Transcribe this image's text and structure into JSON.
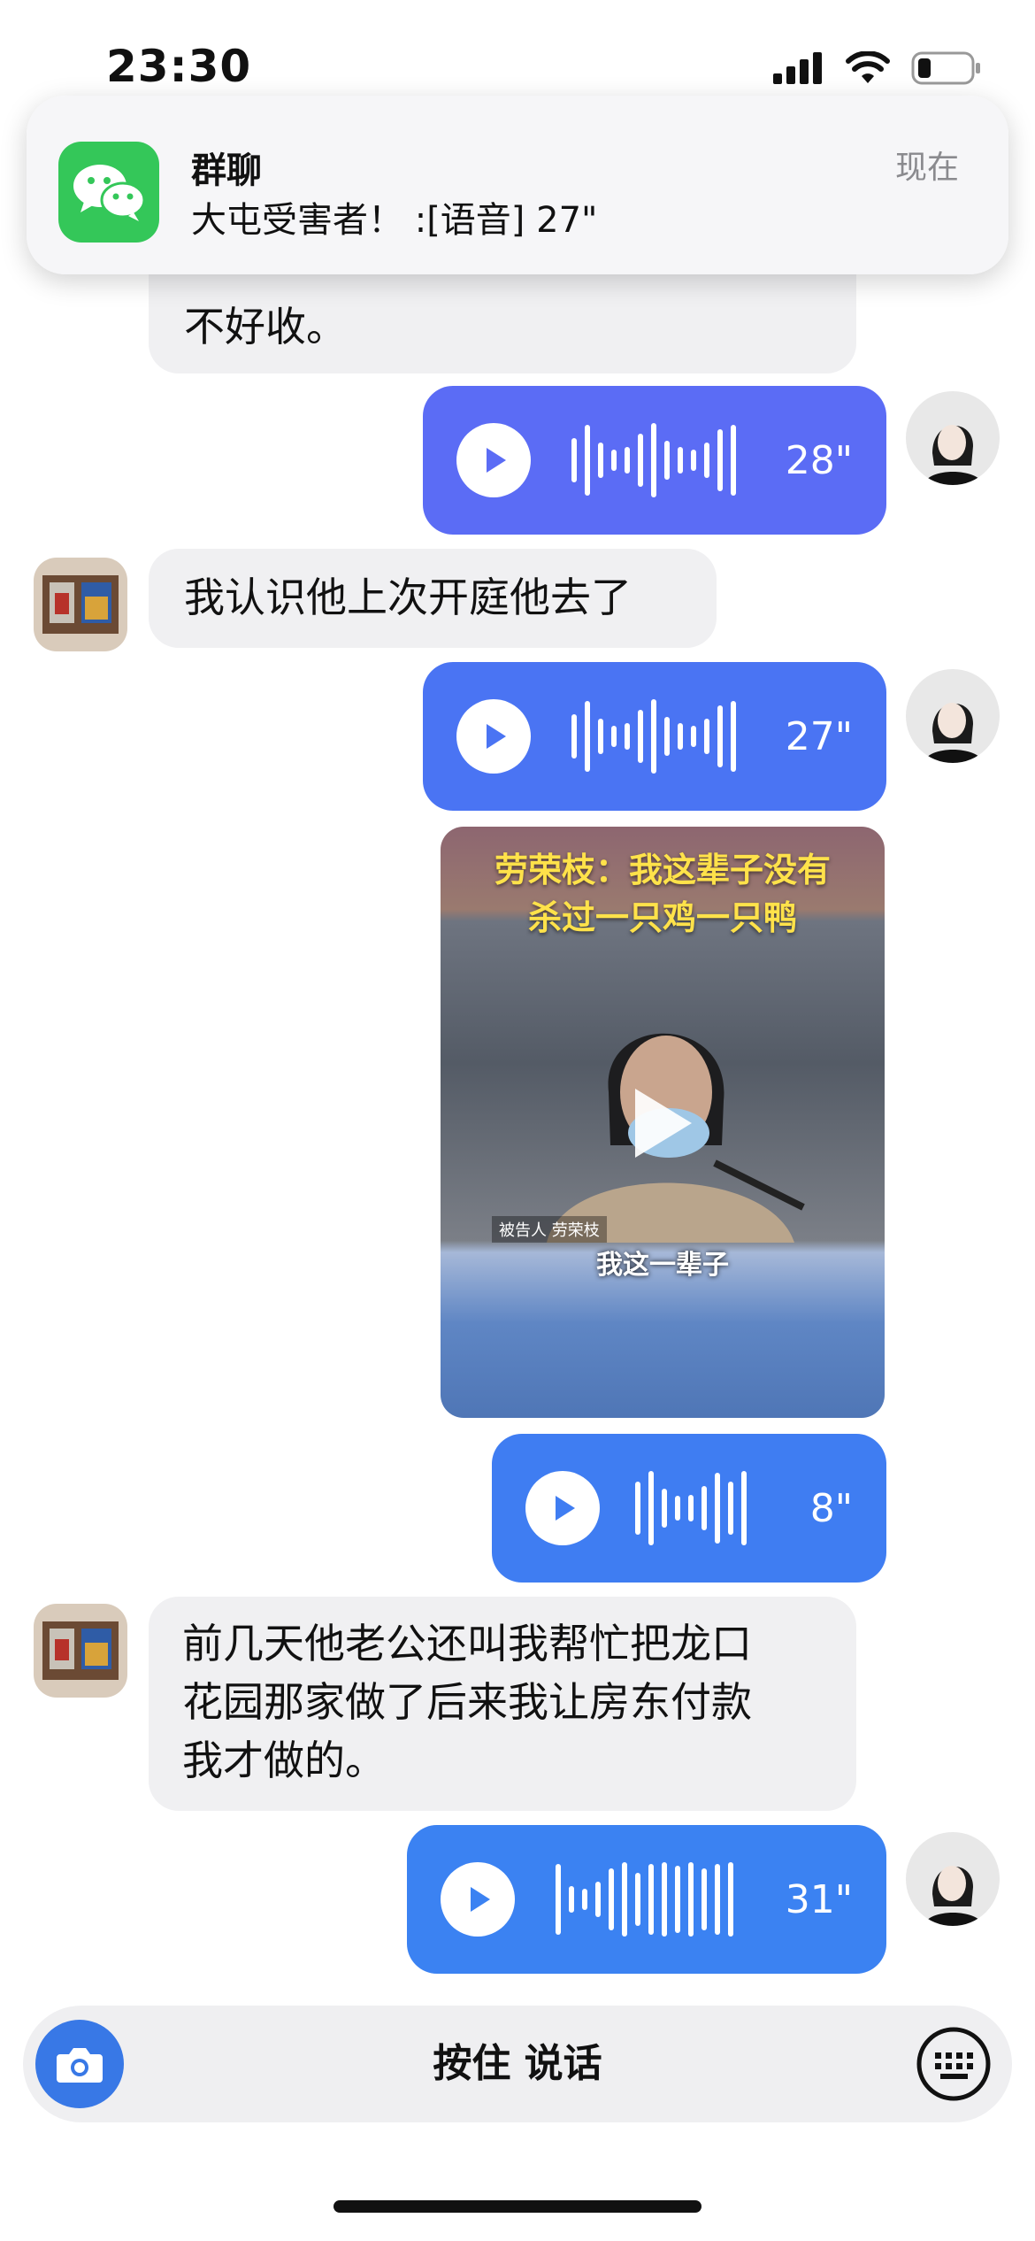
{
  "status_bar": {
    "time": "23:30",
    "battery_icon": "battery-low-icon",
    "wifi_icon": "wifi-icon",
    "signal_icon": "cellular-signal-icon"
  },
  "notification": {
    "app_icon": "wechat-icon",
    "title": "群聊",
    "message": "大屯受害者！ :[语音] 27\"",
    "time": "现在"
  },
  "messages": [
    {
      "type": "text",
      "side": "left",
      "text": "不好收。"
    },
    {
      "type": "voice",
      "side": "right",
      "duration": "28\"",
      "color": "#5b6cf5"
    },
    {
      "type": "text",
      "side": "left",
      "text": "我认识他上次开庭他去了"
    },
    {
      "type": "voice",
      "side": "right",
      "duration": "27\"",
      "color": "#4a74f3"
    },
    {
      "type": "video",
      "side": "right",
      "caption_line1": "劳荣枝：我这辈子没有",
      "caption_line2": "杀过一只鸡一只鸭",
      "label": "被告人 劳荣枝",
      "subtitle": "我这一辈子"
    },
    {
      "type": "voice",
      "side": "right",
      "duration": "8\"",
      "color": "#3f7df2"
    },
    {
      "type": "text",
      "side": "left",
      "lines": [
        "前几天他老公还叫我帮忙把龙口",
        "花园那家做了后来我让房东付款",
        "我才做的。"
      ]
    },
    {
      "type": "voice",
      "side": "right",
      "duration": "31\"",
      "color": "#3b82f2"
    }
  ],
  "input_bar": {
    "camera_icon": "camera-icon",
    "hold_to_talk": "按住 说话",
    "keyboard_icon": "keyboard-icon"
  },
  "colors": {
    "text_bubble": "#f0f0f2",
    "notification_bg": "#f6f6f8",
    "wechat_green": "#34c759",
    "camera_blue": "#3878e6"
  }
}
